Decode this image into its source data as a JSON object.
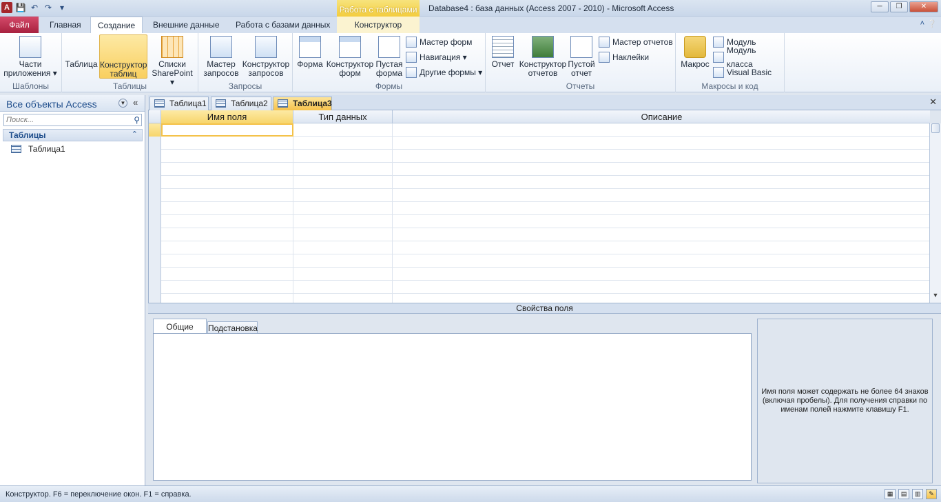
{
  "window": {
    "title": "Database4 : база данных (Access 2007 - 2010)  -  Microsoft Access",
    "context_group": "Работа с таблицами"
  },
  "ribbon_tabs": [
    {
      "label": "Файл"
    },
    {
      "label": "Главная"
    },
    {
      "label": "Создание"
    },
    {
      "label": "Внешние данные"
    },
    {
      "label": "Работа с базами данных"
    },
    {
      "label": "Конструктор"
    }
  ],
  "groups": {
    "templates": {
      "label": "Шаблоны",
      "parts_label_1": "Части",
      "parts_label_2": "приложения ▾"
    },
    "tables": {
      "label": "Таблицы",
      "table": "Таблица",
      "designer_1": "Конструктор",
      "designer_2": "таблиц",
      "sp_1": "Списки",
      "sp_2": "SharePoint ▾"
    },
    "queries": {
      "label": "Запросы",
      "wizard_1": "Мастер",
      "wizard_2": "запросов",
      "designer_1": "Конструктор",
      "designer_2": "запросов"
    },
    "forms": {
      "label": "Формы",
      "form": "Форма",
      "designer_1": "Конструктор",
      "designer_2": "форм",
      "blank_1": "Пустая",
      "blank_2": "форма",
      "wizard": "Мастер форм",
      "navigation": "Навигация ▾",
      "other": "Другие формы ▾"
    },
    "reports": {
      "label": "Отчеты",
      "report": "Отчет",
      "designer_1": "Конструктор",
      "designer_2": "отчетов",
      "blank_1": "Пустой",
      "blank_2": "отчет",
      "wizard": "Мастер отчетов",
      "labels": "Наклейки"
    },
    "macros": {
      "label": "Макросы и код",
      "macro": "Макрос",
      "module": "Модуль",
      "class_module": "Модуль класса",
      "vb": "Visual Basic"
    }
  },
  "nav_pane": {
    "title": "Все объекты Access",
    "search_placeholder": "Поиск...",
    "section": "Таблицы",
    "items": [
      {
        "label": "Таблица1"
      }
    ]
  },
  "doc_tabs": [
    {
      "label": "Таблица1"
    },
    {
      "label": "Таблица2"
    },
    {
      "label": "Таблица3"
    }
  ],
  "design_grid": {
    "columns": [
      "Имя поля",
      "Тип данных",
      "Описание"
    ]
  },
  "field_properties": {
    "header": "Свойства поля",
    "tabs": [
      "Общие",
      "Подстановка"
    ],
    "help_text": "Имя поля может содержать не более 64 знаков (включая пробелы). Для получения справки по именам полей нажмите клавишу F1."
  },
  "status": {
    "text": "Конструктор.  F6 = переключение окон.  F1 = справка."
  }
}
